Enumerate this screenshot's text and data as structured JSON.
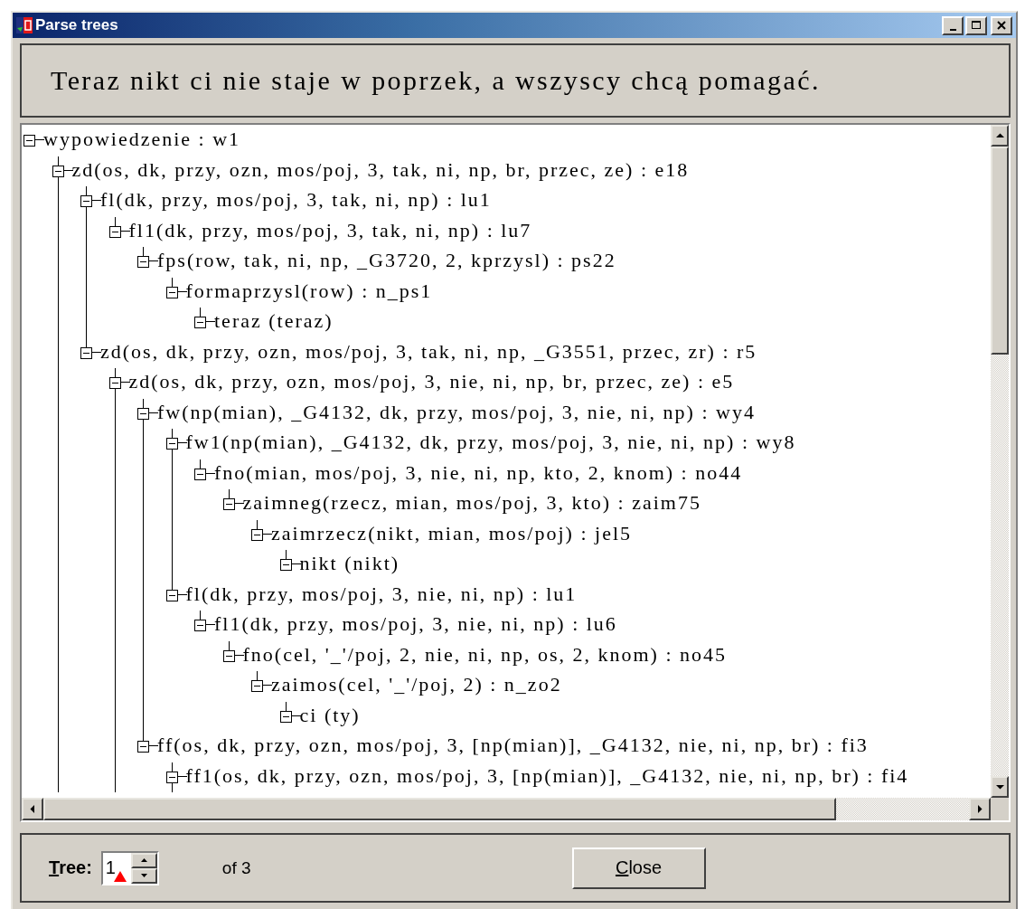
{
  "window": {
    "title": "Parse trees"
  },
  "sentence": "Teraz nikt ci nie staje w poprzek, a wszyscy chcą pomagać.",
  "tree": [
    {
      "label": "wypowiedzenie : w1",
      "expanded": true,
      "children": [
        {
          "label": "zd(os, dk, przy, ozn, mos/poj, 3, tak, ni, np, br, przec, ze) : e18",
          "expanded": true,
          "continues_below": true,
          "children": [
            {
              "label": "fl(dk, przy, mos/poj, 3, tak, ni, np) : lu1",
              "expanded": true,
              "children": [
                {
                  "label": "fl1(dk, przy, mos/poj, 3, tak, ni, np) : lu7",
                  "expanded": true,
                  "children": [
                    {
                      "label": "fps(row, tak, ni, np, _G3720, 2, kprzysl) : ps22",
                      "expanded": true,
                      "children": [
                        {
                          "label": "formaprzysl(row) : n_ps1",
                          "expanded": true,
                          "children": [
                            {
                              "label": "teraz (teraz)",
                              "expanded": true
                            }
                          ]
                        }
                      ]
                    }
                  ]
                }
              ]
            },
            {
              "label": "zd(os, dk, przy, ozn, mos/poj, 3, tak, ni, np, _G3551, przec, zr) : r5",
              "expanded": true,
              "children": [
                {
                  "label": "zd(os, dk, przy, ozn, mos/poj, 3, nie, ni, np, br, przec, ze) : e5",
                  "expanded": true,
                  "continues_below": true,
                  "children": [
                    {
                      "label": "fw(np(mian), _G4132, dk, przy, mos/poj, 3, nie, ni, np) : wy4",
                      "expanded": true,
                      "children": [
                        {
                          "label": "fw1(np(mian), _G4132, dk, przy, mos/poj, 3, nie, ni, np) : wy8",
                          "expanded": true,
                          "children": [
                            {
                              "label": "fno(mian, mos/poj, 3, nie, ni, np, kto, 2, knom) : no44",
                              "expanded": true,
                              "children": [
                                {
                                  "label": "zaimneg(rzecz, mian, mos/poj, 3, kto) : zaim75",
                                  "expanded": true,
                                  "children": [
                                    {
                                      "label": "zaimrzecz(nikt, mian, mos/poj) : jel5",
                                      "expanded": true,
                                      "children": [
                                        {
                                          "label": "nikt (nikt)",
                                          "expanded": true
                                        }
                                      ]
                                    }
                                  ]
                                }
                              ]
                            }
                          ]
                        },
                        {
                          "label": "fl(dk, przy, mos/poj, 3, nie, ni, np) : lu1",
                          "expanded": true,
                          "children": [
                            {
                              "label": "fl1(dk, przy, mos/poj, 3, nie, ni, np) : lu6",
                              "expanded": true,
                              "children": [
                                {
                                  "label": "fno(cel, '_'/poj, 2, nie, ni, np, os, 2, knom) : no45",
                                  "expanded": true,
                                  "children": [
                                    {
                                      "label": "zaimos(cel, '_'/poj, 2) : n_zo2",
                                      "expanded": true,
                                      "children": [
                                        {
                                          "label": "ci (ty)",
                                          "expanded": true
                                        }
                                      ]
                                    }
                                  ]
                                }
                              ]
                            }
                          ]
                        }
                      ]
                    },
                    {
                      "label": "ff(os, dk, przy, ozn, mos/poj, 3, [np(mian)], _G4132, nie, ni, np, br) : fi3",
                      "expanded": true,
                      "children": [
                        {
                          "label": "ff1(os, dk, przy, ozn, mos/poj, 3, [np(mian)], _G4132, nie, ni, np, br) : fi4",
                          "expanded": true,
                          "continues_below": true
                        }
                      ]
                    }
                  ]
                }
              ]
            }
          ]
        }
      ]
    }
  ],
  "footer": {
    "tree_label": "Tree:",
    "tree_value": "1",
    "of_text": "of 3",
    "close_button": "Close"
  }
}
